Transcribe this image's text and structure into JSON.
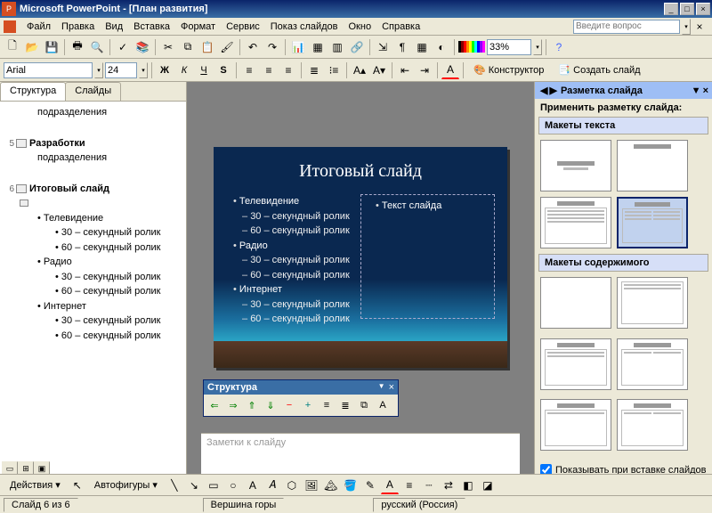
{
  "title": "Microsoft PowerPoint - [План развития]",
  "menu": [
    "Файл",
    "Правка",
    "Вид",
    "Вставка",
    "Формат",
    "Сервис",
    "Показ слайдов",
    "Окно",
    "Справка"
  ],
  "ask_placeholder": "Введите вопрос",
  "font": {
    "name": "Arial",
    "size": "24"
  },
  "zoom": "33%",
  "designer": "Конструктор",
  "newslide": "Создать слайд",
  "tabs": {
    "structure": "Структура",
    "slides": "Слайды",
    "structure_panel": "Структура"
  },
  "outline": {
    "s4": "подразделения",
    "s5_num": "5",
    "s5": "Разработки",
    "s5a": "подразделения",
    "s6_num": "6",
    "s6": "Итоговый слайд",
    "s6_1": "Телевидение",
    "s6_1a": "30 – секундный ролик",
    "s6_1b": "60 – секундный ролик",
    "s6_2": "Радио",
    "s6_2a": "30 – секундный ролик",
    "s6_2b": "60 – секундный ролик",
    "s6_3": "Интернет",
    "s6_3a": "30 – секундный ролик",
    "s6_3b": "60 – секундный ролик"
  },
  "slide": {
    "title": "Итоговый слайд",
    "g1": "Телевидение",
    "g1a": "30 – секундный ролик",
    "g1b": "60 – секундный ролик",
    "g2": "Радио",
    "g2a": "30 – секундный ролик",
    "g2b": "60 – секундный ролик",
    "g3": "Интернет",
    "g3a": "30 – секундный ролик",
    "g3b": "60 – секундный ролик",
    "right": "Текст слайда"
  },
  "notes": "Заметки к слайду",
  "taskpane": {
    "title": "Разметка слайда",
    "apply": "Применить разметку слайда:",
    "sec1": "Макеты текста",
    "sec2": "Макеты содержимого",
    "show": "Показывать при вставке слайдов"
  },
  "draw": {
    "actions": "Действия",
    "autoshapes": "Автофигуры"
  },
  "status": {
    "slide": "Слайд 6 из 6",
    "design": "Вершина горы",
    "lang": "русский (Россия)"
  }
}
